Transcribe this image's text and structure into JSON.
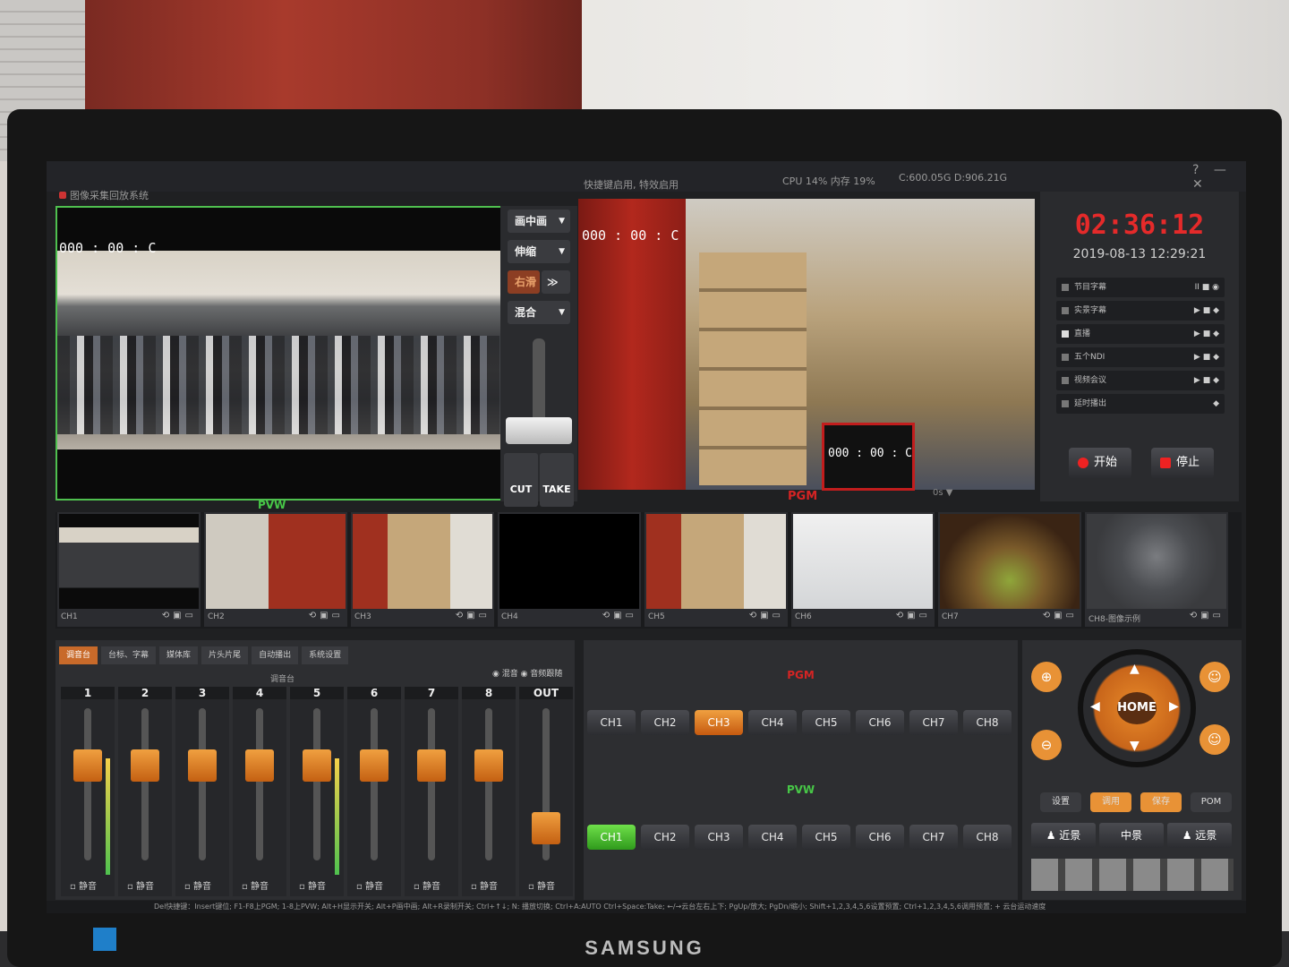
{
  "window": {
    "title": "图像采集回放系统",
    "notice": "快捷键启用, 特效启用",
    "cpu": "CPU 14% 内存 19%",
    "disk": "C:600.05G D:906.21G",
    "controls": "? — ✕"
  },
  "pvw": {
    "timecode": "000 : 00 : C",
    "label": "PVW"
  },
  "pgm": {
    "timecode": "000 : 00 : C",
    "inset_timecode": "000 : 00 : C",
    "label": "PGM",
    "bar": "0s ▼"
  },
  "switcher": {
    "pip": "画中画",
    "scale": "伸缩",
    "right": "右滑",
    "mix": "混合",
    "cut": "CUT",
    "take": "TAKE"
  },
  "clock": {
    "time": "02:36:12",
    "date": "2019-08-13 12:29:21",
    "rows": [
      {
        "label": "节目字幕",
        "ctl": "II ■ ◉"
      },
      {
        "label": "实景字幕",
        "ctl": "▶ ■ ◆"
      },
      {
        "label": "直播",
        "ctl": "▶ ■ ◆"
      },
      {
        "label": "五个NDI",
        "ctl": "▶ ■ ◆"
      },
      {
        "label": "视频会议",
        "ctl": "▶ ■ ◆"
      },
      {
        "label": "延时播出",
        "ctl": "◆"
      }
    ],
    "start": "开始",
    "stop": "停止"
  },
  "thumbnails": [
    {
      "label": "CH1"
    },
    {
      "label": "CH2"
    },
    {
      "label": "CH3"
    },
    {
      "label": "CH4"
    },
    {
      "label": "CH5"
    },
    {
      "label": "CH6"
    },
    {
      "label": "CH7"
    },
    {
      "label": "CH8-图像示例"
    }
  ],
  "mixer": {
    "tabs": [
      "调音台",
      "台标、字幕",
      "媒体库",
      "片头片尾",
      "自动播出",
      "系统设置"
    ],
    "title": "调音台",
    "options": "◉ 混音  ◉ 音频跟随",
    "channels": [
      "1",
      "2",
      "3",
      "4",
      "5",
      "6",
      "7",
      "8",
      "OUT"
    ],
    "mute": "静音"
  },
  "selectors": {
    "pgm_label": "PGM",
    "pvw_label": "PVW",
    "pgm": [
      "CH1",
      "CH2",
      "CH3",
      "CH4",
      "CH5",
      "CH6",
      "CH7",
      "CH8"
    ],
    "pvw": [
      "CH1",
      "CH2",
      "CH3",
      "CH4",
      "CH5",
      "CH6",
      "CH7",
      "CH8"
    ]
  },
  "ptz": {
    "home": "HOME",
    "buttons": [
      "设置",
      "调用",
      "保存",
      "POM"
    ],
    "presets": [
      "近景",
      "中景",
      "远景"
    ]
  },
  "status": "Del快捷键：Insert键位; F1-F8上PGM; 1-8上PVW; Alt+H显示开关; Alt+P画中画; Alt+R录制开关; Ctrl+↑↓; N: 播放切换; Ctrl+A:AUTO Ctrl+Space:Take; ←/→云台左右上下; PgUp/放大; PgDn/缩小; Shift+1,2,3,4,5,6设置预置; Ctrl+1,2,3,4,5,6调用预置; + 云台运动速度",
  "monitor_brand": "SAMSUNG"
}
